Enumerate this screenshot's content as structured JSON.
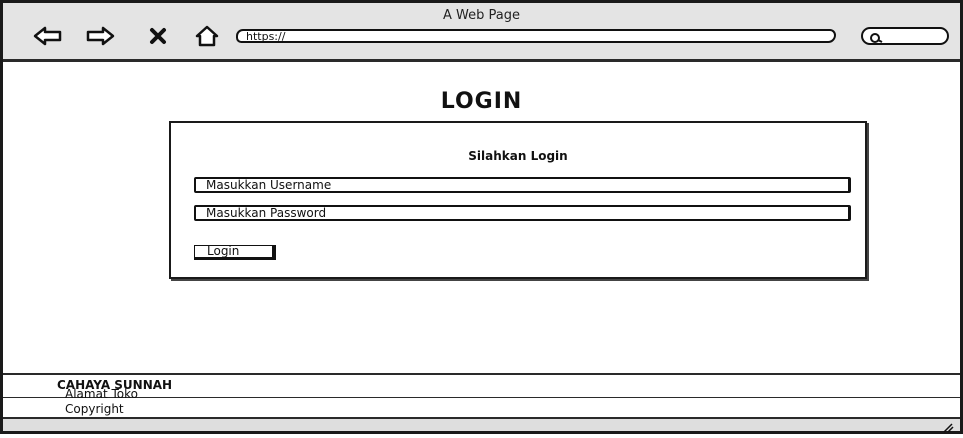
{
  "browser": {
    "window_title": "A Web Page",
    "url": "https://",
    "icons": [
      "back-arrow-icon",
      "forward-arrow-icon",
      "close-x-icon",
      "home-icon",
      "search-icon"
    ]
  },
  "page": {
    "title": "LOGIN",
    "panel_heading": "Silahkan Login",
    "username_placeholder": "Masukkan Username",
    "password_placeholder": "Masukkan Password",
    "login_button": "Login"
  },
  "footer": {
    "store_name": "CAHAYA SUNNAH",
    "store_address": "Alamat Toko",
    "copyright": "Copyright"
  },
  "colors": {
    "chrome": "#e4e4e4",
    "border": "#1a1a1a",
    "background": "#ffffff"
  }
}
